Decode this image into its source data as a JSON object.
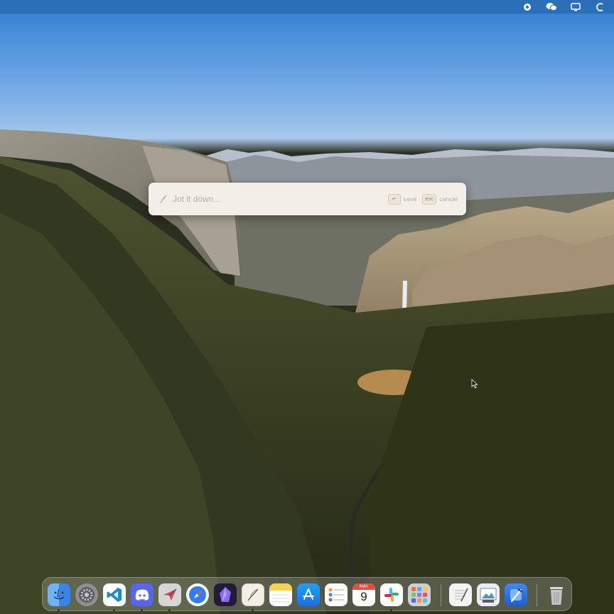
{
  "note": {
    "placeholder": "Jot it down...",
    "save_key": "↵",
    "save_label": "save",
    "cancel_key": "esc",
    "cancel_label": "cancel"
  },
  "menubar": {
    "icons": [
      "record-icon",
      "wechat-icon",
      "display-icon",
      "control-center-icon"
    ]
  },
  "dock": {
    "apps": [
      {
        "name": "finder-icon",
        "color": "#3f8ff0"
      },
      {
        "name": "system-settings-icon",
        "color": "#8e8e93"
      },
      {
        "name": "vscode-icon",
        "color": "#1f8ad2"
      },
      {
        "name": "discord-icon",
        "color": "#5865f2"
      },
      {
        "name": "airmail-icon",
        "color": "#d9d9d9"
      },
      {
        "name": "safari-icon",
        "color": "#2f7ef5"
      },
      {
        "name": "obsidian-icon",
        "color": "#2b2340"
      },
      {
        "name": "quill-icon",
        "color": "#f3efe6"
      },
      {
        "name": "notes-icon",
        "color": "#f7d34a"
      },
      {
        "name": "app-store-icon",
        "color": "#1e8df4"
      },
      {
        "name": "reminders-icon",
        "color": "#ffffff"
      },
      {
        "name": "calendar-icon",
        "color": "#ffffff"
      },
      {
        "name": "slack-icon",
        "color": "#ffffff"
      },
      {
        "name": "launchpad-icon",
        "color": "#d8d8d8"
      },
      {
        "name": "textedit-icon",
        "color": "#f2f2f2"
      },
      {
        "name": "preview-icon",
        "color": "#4a90d9"
      },
      {
        "name": "xcode-icon",
        "color": "#2f7ef5"
      },
      {
        "name": "trash-icon",
        "color": "#cfcfcf"
      }
    ],
    "calendar": {
      "month": "MAY",
      "day": "9"
    }
  }
}
